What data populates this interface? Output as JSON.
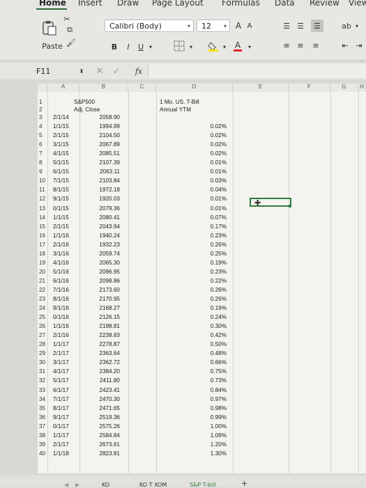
{
  "ribbon": {
    "tabs": [
      "Home",
      "Insert",
      "Draw",
      "Page Layout",
      "Formulas",
      "Data",
      "Review",
      "View"
    ],
    "paste_label": "Paste",
    "font_name": "Calibri (Body)",
    "font_size": "12",
    "grow_font": "A",
    "shrink_font": "A",
    "bold": "B",
    "italic": "I",
    "underline": "U",
    "font_color": "A",
    "wrap_icon": "wrap-text-icon"
  },
  "formula_bar": {
    "name_box": "F11",
    "fx": "fx",
    "value": ""
  },
  "columns": [
    "A",
    "B",
    "C",
    "D",
    "E",
    "F",
    "G",
    "H"
  ],
  "header_rows": [
    {
      "n": "1",
      "b": "S&P500",
      "d": "1 Mo. US. T-Bill"
    },
    {
      "n": "2",
      "b": "Adj. Close",
      "d": "Annual YTM"
    }
  ],
  "rows": [
    {
      "n": "3",
      "a": "2/1/14",
      "b": "2058.90",
      "d": ""
    },
    {
      "n": "4",
      "a": "1/1/15",
      "b": "1994.99",
      "d": "0.02%"
    },
    {
      "n": "5",
      "a": "2/1/15",
      "b": "2104.50",
      "d": "0.02%"
    },
    {
      "n": "6",
      "a": "3/1/15",
      "b": "2067.89",
      "d": "0.02%"
    },
    {
      "n": "7",
      "a": "4/1/15",
      "b": "2085.51",
      "d": "0.02%"
    },
    {
      "n": "8",
      "a": "5/1/15",
      "b": "2107.39",
      "d": "0.01%"
    },
    {
      "n": "9",
      "a": "6/1/15",
      "b": "2063.11",
      "d": "0.01%"
    },
    {
      "n": "10",
      "a": "7/1/15",
      "b": "2103.84",
      "d": "0.03%"
    },
    {
      "n": "11",
      "a": "8/1/15",
      "b": "1972.18",
      "d": "0.04%"
    },
    {
      "n": "12",
      "a": "9/1/15",
      "b": "1920.03",
      "d": "0.01%"
    },
    {
      "n": "13",
      "a": "0/1/15",
      "b": "2079.36",
      "d": "0.01%"
    },
    {
      "n": "14",
      "a": "1/1/15",
      "b": "2080.41",
      "d": "0.07%"
    },
    {
      "n": "15",
      "a": "2/1/15",
      "b": "2043.94",
      "d": "0.17%"
    },
    {
      "n": "16",
      "a": "1/1/16",
      "b": "1940.24",
      "d": "0.23%"
    },
    {
      "n": "17",
      "a": "2/1/16",
      "b": "1932.23",
      "d": "0.26%"
    },
    {
      "n": "18",
      "a": "3/1/16",
      "b": "2059.74",
      "d": "0.25%"
    },
    {
      "n": "19",
      "a": "4/1/16",
      "b": "2065.30",
      "d": "0.19%"
    },
    {
      "n": "20",
      "a": "5/1/16",
      "b": "2096.95",
      "d": "0.23%"
    },
    {
      "n": "21",
      "a": "6/1/16",
      "b": "2098.86",
      "d": "0.22%"
    },
    {
      "n": "22",
      "a": "7/1/16",
      "b": "2173.60",
      "d": "0.26%"
    },
    {
      "n": "23",
      "a": "8/1/16",
      "b": "2170.95",
      "d": "0.26%"
    },
    {
      "n": "24",
      "a": "9/1/16",
      "b": "2168.27",
      "d": "0.19%"
    },
    {
      "n": "25",
      "a": "0/1/16",
      "b": "2126.15",
      "d": "0.24%"
    },
    {
      "n": "26",
      "a": "1/1/16",
      "b": "2198.81",
      "d": "0.30%"
    },
    {
      "n": "27",
      "a": "2/1/16",
      "b": "2238.83",
      "d": "0.42%"
    },
    {
      "n": "28",
      "a": "1/1/17",
      "b": "2278.87",
      "d": "0.50%"
    },
    {
      "n": "29",
      "a": "2/1/17",
      "b": "2363.64",
      "d": "0.48%"
    },
    {
      "n": "30",
      "a": "3/1/17",
      "b": "2362.72",
      "d": "0.66%"
    },
    {
      "n": "31",
      "a": "4/1/17",
      "b": "2384.20",
      "d": "0.75%"
    },
    {
      "n": "32",
      "a": "5/1/17",
      "b": "2411.80",
      "d": "0.73%"
    },
    {
      "n": "33",
      "a": "6/1/17",
      "b": "2423.41",
      "d": "0.84%"
    },
    {
      "n": "34",
      "a": "7/1/17",
      "b": "2470.30",
      "d": "0.97%"
    },
    {
      "n": "35",
      "a": "8/1/17",
      "b": "2471.65",
      "d": "0.98%"
    },
    {
      "n": "36",
      "a": "9/1/17",
      "b": "2519.36",
      "d": "0.99%"
    },
    {
      "n": "37",
      "a": "0/1/17",
      "b": "2575.26",
      "d": "1.00%"
    },
    {
      "n": "38",
      "a": "1/1/17",
      "b": "2584.84",
      "d": "1.09%"
    },
    {
      "n": "39",
      "a": "2/1/17",
      "b": "2673.61",
      "d": "1.20%"
    },
    {
      "n": "40",
      "a": "1/1/18",
      "b": "2823.81",
      "d": "1.30%"
    }
  ],
  "sheet_tabs": [
    "KO",
    "KO T XOM",
    "S&P T-bill"
  ],
  "add_sheet": "+"
}
